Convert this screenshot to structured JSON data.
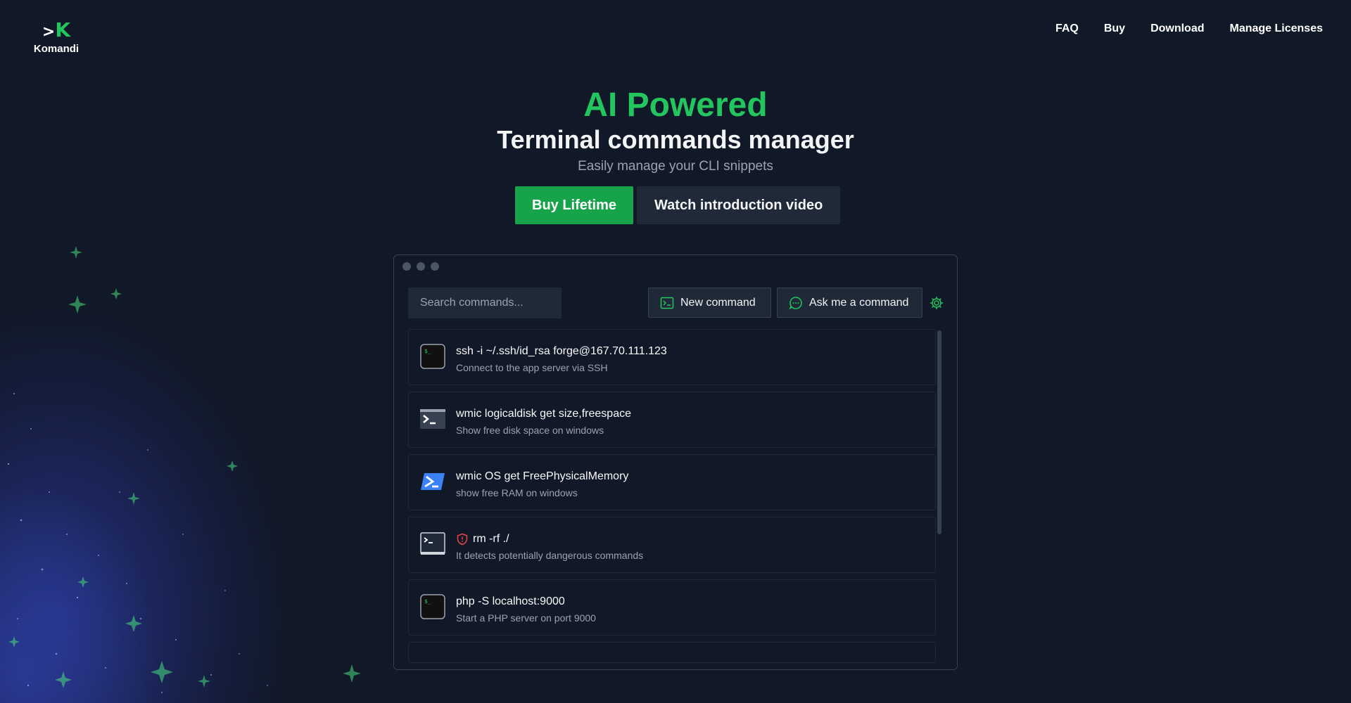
{
  "brand": {
    "mark_prefix": ">",
    "mark_letter": "K",
    "name": "Komandi"
  },
  "nav": {
    "items": [
      {
        "label": "FAQ"
      },
      {
        "label": "Buy"
      },
      {
        "label": "Download"
      },
      {
        "label": "Manage Licenses"
      }
    ]
  },
  "hero": {
    "title": "AI Powered",
    "subtitle": "Terminal commands manager",
    "tagline": "Easily manage your CLI snippets"
  },
  "cta": {
    "primary_label": "Buy Lifetime",
    "secondary_label": "Watch introduction video"
  },
  "app": {
    "search": {
      "placeholder": "Search commands...",
      "value": ""
    },
    "new_command_label": "New command",
    "ask_label": "Ask me a command",
    "commands": [
      {
        "cmd": "ssh -i ~/.ssh/id_rsa forge@167.70.111.123",
        "desc": "Connect to the app server via SSH",
        "icon": "terminal-green-icon"
      },
      {
        "cmd": "wmic logicaldisk get size,freespace",
        "desc": "Show free disk space on windows",
        "icon": "cmd-prompt-icon"
      },
      {
        "cmd": "wmic OS get FreePhysicalMemory",
        "desc": "show free RAM on windows",
        "icon": "powershell-icon"
      },
      {
        "cmd": "rm -rf ./",
        "desc": "It detects potentially dangerous commands",
        "icon": "terminal-window-icon",
        "danger_icon": "shield-alert-icon"
      },
      {
        "cmd": "php -S localhost:9000",
        "desc": "Start a PHP server on port 9000",
        "icon": "terminal-green-icon"
      }
    ]
  },
  "colors": {
    "background": "#111827",
    "accent": "#22c55e",
    "primary_button": "#16a34a",
    "panel": "#1f2937",
    "danger": "#ef4444"
  }
}
